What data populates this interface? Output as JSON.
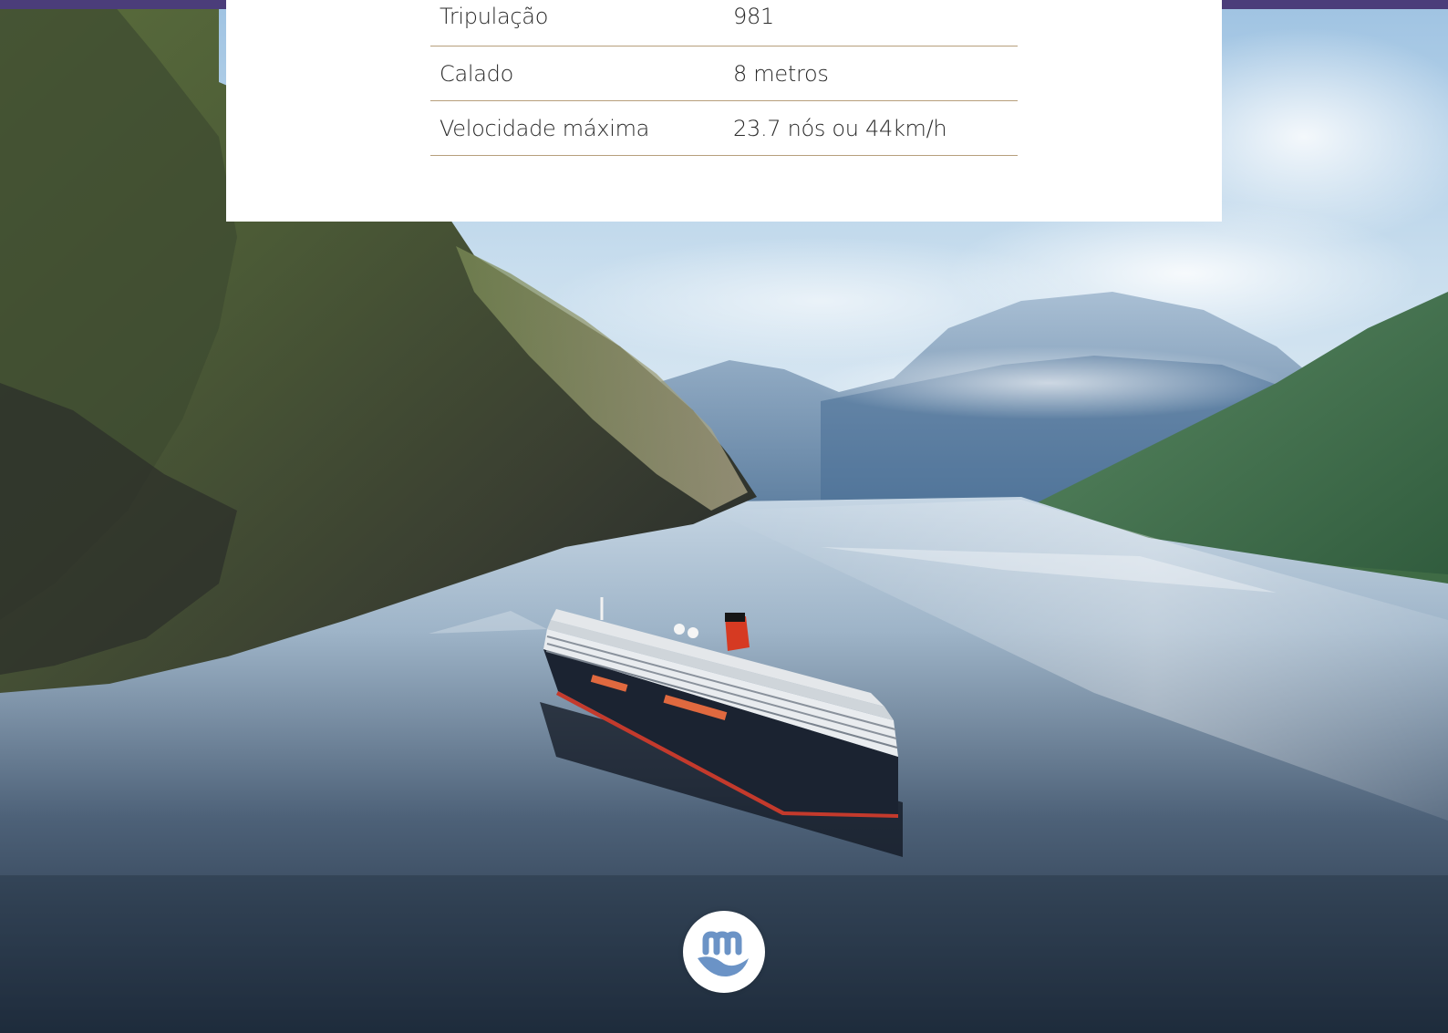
{
  "specs": [
    {
      "label": "Tripulação",
      "value": "981"
    },
    {
      "label": "Calado",
      "value": "8 metros"
    },
    {
      "label": "Velocidade máxima",
      "value": "23.7 nós ou 44km/h"
    }
  ],
  "icons": {
    "logo": "brand-wave-m-icon"
  },
  "colors": {
    "top_bar": "#4b3d7a",
    "divider": "#b79f7c",
    "logo_mark": "#6b93c6",
    "ship_funnel": "#d63a22"
  }
}
